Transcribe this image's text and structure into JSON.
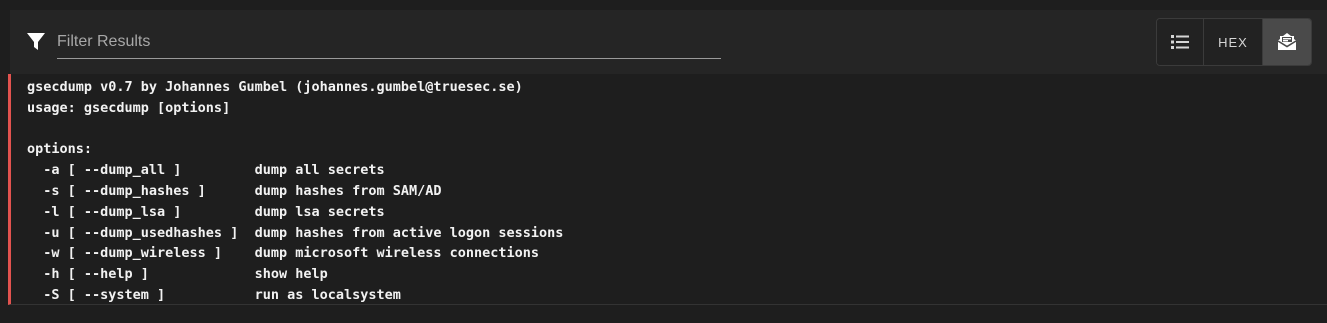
{
  "filter": {
    "icon": "filter-icon",
    "placeholder": "Filter Results",
    "value": ""
  },
  "view_toggle": {
    "list_icon": "list-icon",
    "hex_label": "HEX",
    "decoded_icon": "decoded-view-icon",
    "active": "decoded"
  },
  "colors": {
    "accent_bar": "#e2534f"
  },
  "output": {
    "text": "gsecdump v0.7 by Johannes Gumbel (johannes.gumbel@truesec.se)\nusage: gsecdump [options]\n\noptions:\n  -a [ --dump_all ]         dump all secrets\n  -s [ --dump_hashes ]      dump hashes from SAM/AD\n  -l [ --dump_lsa ]         dump lsa secrets\n  -u [ --dump_usedhashes ]  dump hashes from active logon sessions\n  -w [ --dump_wireless ]    dump microsoft wireless connections\n  -h [ --help ]             show help\n  -S [ --system ]           run as localsystem"
  }
}
